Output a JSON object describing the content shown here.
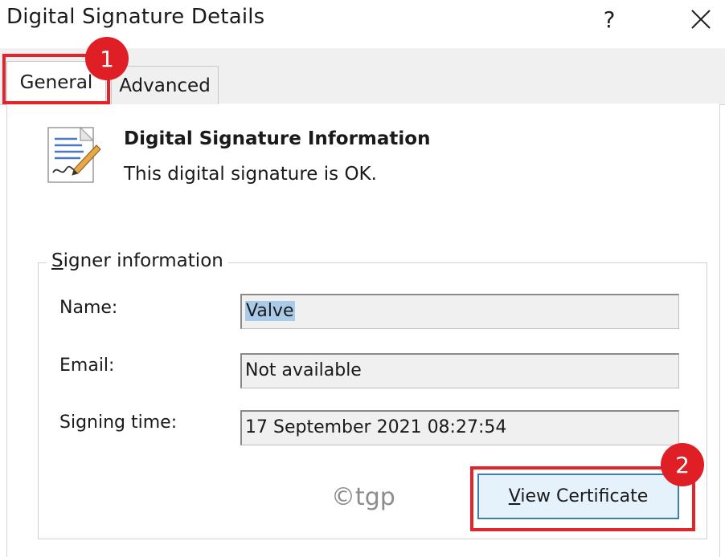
{
  "window": {
    "title": "Digital Signature Details",
    "help_label": "?"
  },
  "tabs": [
    {
      "label": "General",
      "active": true
    },
    {
      "label": "Advanced",
      "active": false
    }
  ],
  "annotations": {
    "badge_1": "1",
    "badge_2": "2",
    "highlight_color": "#e3242b"
  },
  "info": {
    "heading": "Digital Signature Information",
    "status": "This digital signature is OK.",
    "icon": "signed-document-icon"
  },
  "signer": {
    "group_label_first": "S",
    "group_label_rest": "igner information",
    "fields": [
      {
        "label": "Name:",
        "value": "Valve"
      },
      {
        "label": "Email:",
        "value": "Not available"
      },
      {
        "label": "Signing time:",
        "value": "17 September 2021 08:27:54"
      }
    ]
  },
  "buttons": {
    "view_certificate_first": "V",
    "view_certificate_rest": "iew Certificate"
  },
  "watermark": "©tgp",
  "colors": {
    "accent_button_bg": "#e5f1fb",
    "accent_button_border": "#3c7fb1",
    "selection": "#aacbe8",
    "badge": "#e01e26"
  }
}
